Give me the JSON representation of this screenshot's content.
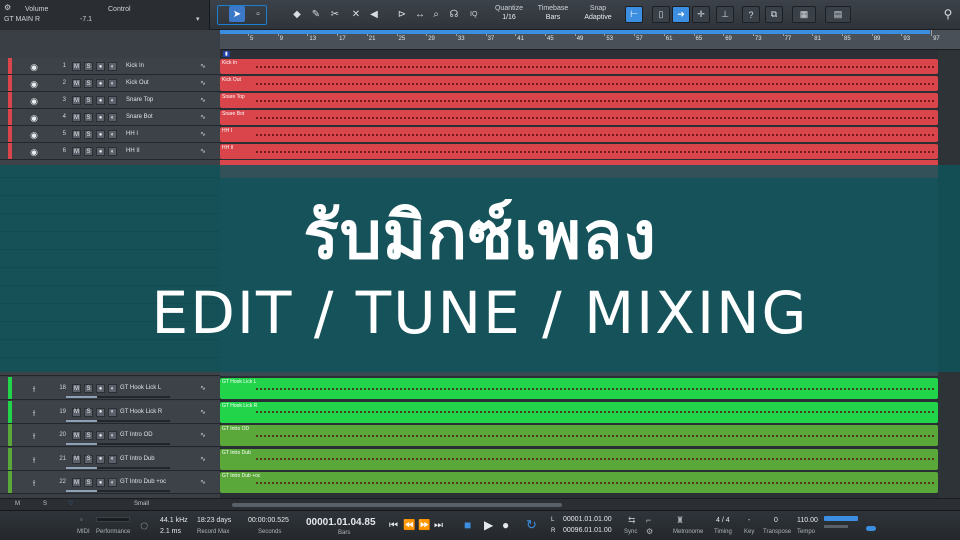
{
  "top": {
    "inspector_label": "Volume",
    "control_label": "Control",
    "track_label": "GT MAIN R",
    "volume_value": "-7.1",
    "quantize_label": "Quantize",
    "quantize_value": "1/16",
    "timebase_label": "Timebase",
    "timebase_value": "Bars",
    "snap_label": "Snap",
    "snap_value": "Adaptive",
    "iq_label": "IQ"
  },
  "ruler": {
    "bars": [
      "5",
      "9",
      "13",
      "17",
      "21",
      "25",
      "29",
      "33",
      "37",
      "41",
      "45",
      "49",
      "53",
      "57",
      "61",
      "65",
      "69",
      "73",
      "77",
      "81",
      "85",
      "89",
      "93",
      "97"
    ]
  },
  "tracks_top": [
    {
      "num": "1",
      "name": "Kick In",
      "clip": "Kick In"
    },
    {
      "num": "2",
      "name": "Kick Out",
      "clip": "Kick Out"
    },
    {
      "num": "3",
      "name": "Snare Top",
      "clip": "Snare Top"
    },
    {
      "num": "4",
      "name": "Snare Bot",
      "clip": "Snare Bot"
    },
    {
      "num": "5",
      "name": "HH I",
      "clip": "HH I"
    },
    {
      "num": "6",
      "name": "HH II",
      "clip": "HH II"
    }
  ],
  "tracks_bottom": [
    {
      "num": "18",
      "name": "GT Hook Lick L",
      "clip": "GT Hook Lick L"
    },
    {
      "num": "19",
      "name": "GT Hook Lick R",
      "clip": "GT Hook Lick R"
    },
    {
      "num": "20",
      "name": "GT Intro OD",
      "clip": "GT Intro OD"
    },
    {
      "num": "21",
      "name": "GT Intro Dub",
      "clip": "GT Intro Dub"
    },
    {
      "num": "22",
      "name": "GT Intro Dub +oc",
      "clip": "GT Intro Dub +oc"
    }
  ],
  "track_buttons": {
    "mute": "M",
    "solo": "S"
  },
  "banner": {
    "thai": "รับมิกซ์เพลง",
    "english": "EDIT / TUNE / MIXING"
  },
  "bottom_bar": {
    "m": "M",
    "s": "S",
    "size": "Small"
  },
  "transport": {
    "midi_label": "MIDI",
    "performance_label": "Performance",
    "sample_rate": "44.1 kHz",
    "latency": "2.1 ms",
    "record_days": "18:23 days",
    "record_max_label": "Record Max",
    "seconds_value": "00:00:00.525",
    "seconds_label": "Seconds",
    "bars_value": "00001.01.04.85",
    "bars_label": "Bars",
    "loop_l_label": "L",
    "loop_r_label": "R",
    "loop_l": "00001.01.01.00",
    "loop_r": "00096.01.01.00",
    "sync_label": "Sync",
    "metronome_label": "Metronome",
    "timing_value": "4 / 4",
    "timing_label": "Timing",
    "key_value": "-",
    "key_label": "Key",
    "transpose_value": "0",
    "transpose_label": "Transpose",
    "tempo_value": "110.00",
    "tempo_label": "Tempo"
  },
  "colors": {
    "drums": "#d9454a",
    "guitar_bright": "#22d44a",
    "guitar_dark": "#5aa83a",
    "accent": "#3b8ee0"
  }
}
